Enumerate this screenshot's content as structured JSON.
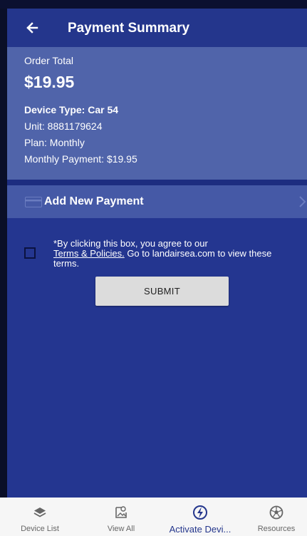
{
  "header": {
    "title": "Payment Summary"
  },
  "summary": {
    "order_label": "Order Total",
    "order_total": "$19.95",
    "device_type": "Device Type:  Car 54",
    "unit": "Unit:  8881179624",
    "plan": "Plan:  Monthly",
    "monthly_payment": "Monthly Payment:  $19.95"
  },
  "payment": {
    "add_label": "Add New Payment"
  },
  "agreement": {
    "prefix": "*By clicking this box, you agree to our",
    "link": "Terms & Policies.",
    "suffix": " Go to landairsea.com to view these terms.",
    "checked": false
  },
  "form": {
    "submit_label": "SUBMIT"
  },
  "bottom_nav": {
    "items": [
      {
        "label": "Device List",
        "icon": "layers-icon"
      },
      {
        "label": "View All",
        "icon": "image-icon"
      },
      {
        "label": "Activate Devi...",
        "icon": "bolt-icon",
        "active": true
      },
      {
        "label": "Resources",
        "icon": "soccer-ball-icon"
      }
    ]
  },
  "colors": {
    "header": "#24368c",
    "summary_panel": "#5064aa",
    "payment_row": "#4559a6",
    "main_bg": "#243690",
    "active_nav": "#24368c"
  }
}
